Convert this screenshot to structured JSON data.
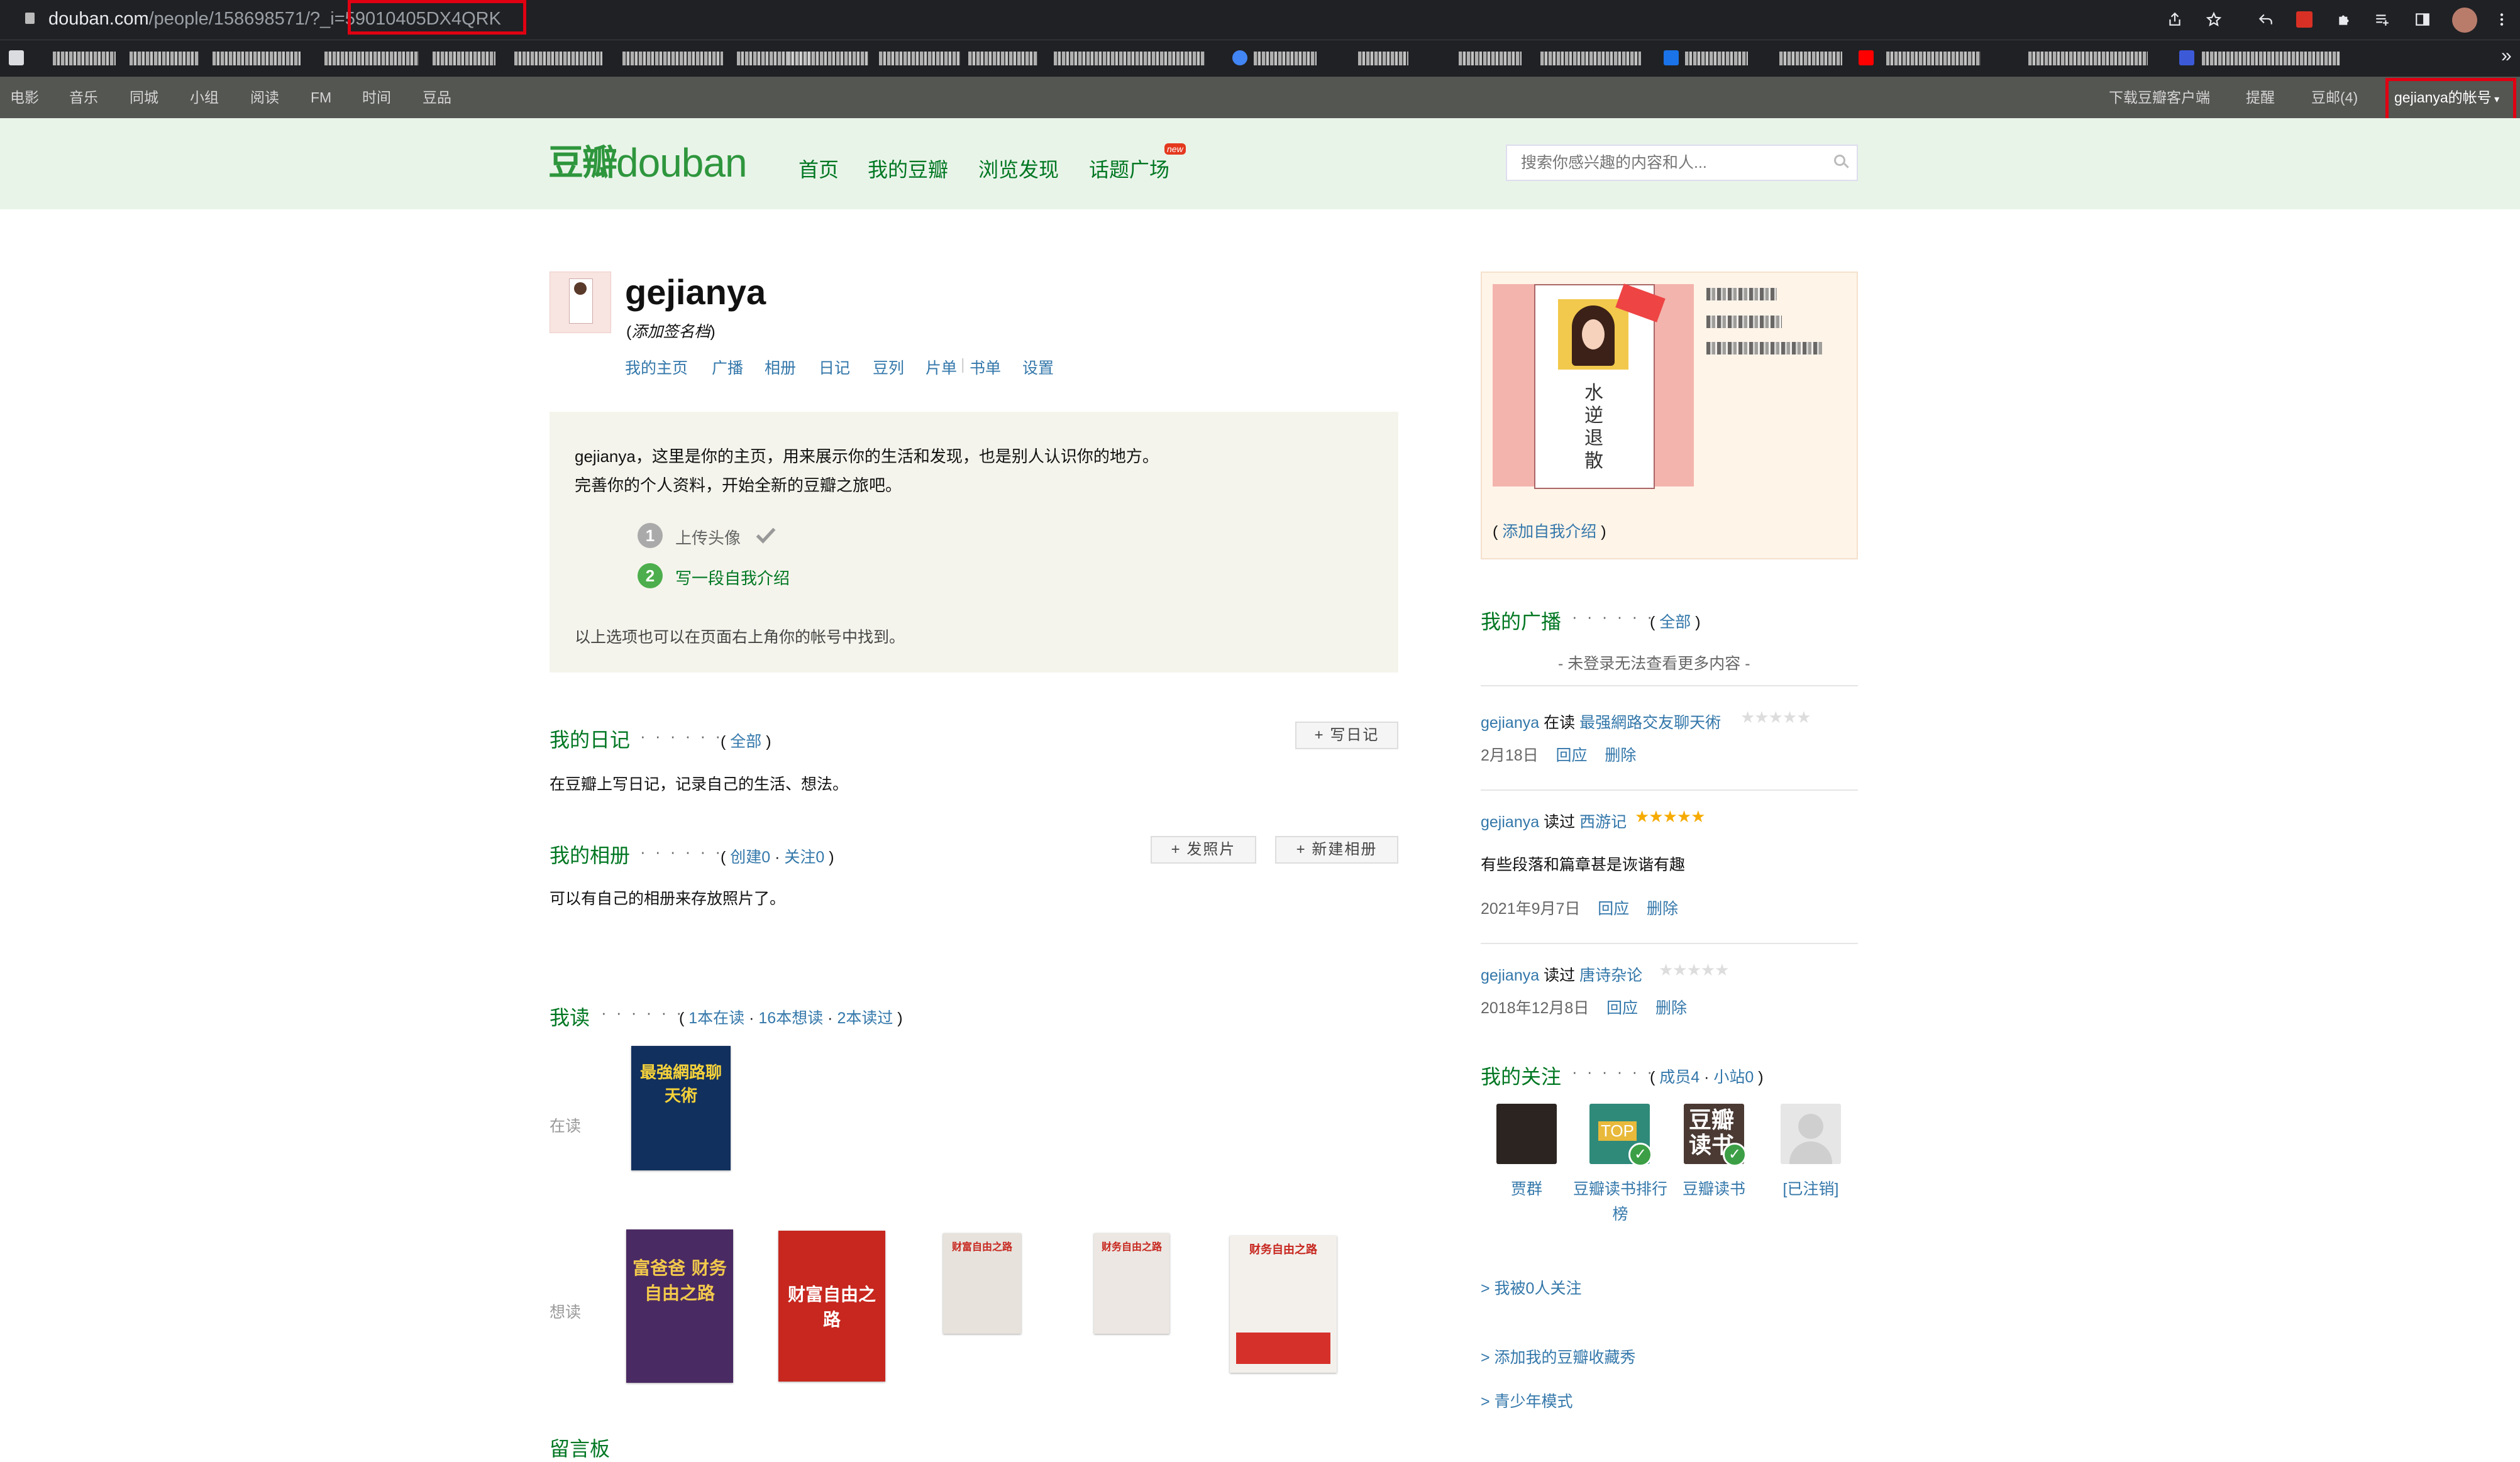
{
  "browser": {
    "url_host": "douban.com",
    "url_path": "/people/158698571/?_i=",
    "url_token": "59010405DX4QRK"
  },
  "global_nav": {
    "items": [
      "电影",
      "音乐",
      "同城",
      "小组",
      "阅读",
      "FM",
      "时间",
      "豆品"
    ],
    "right_items": [
      "下载豆瓣客户端",
      "提醒",
      "豆邮(4)"
    ],
    "account": "gejianya的帐号"
  },
  "header": {
    "logo_cn": "豆瓣",
    "logo_en": "douban",
    "nav": [
      "首页",
      "我的豆瓣",
      "浏览发现",
      "话题广场"
    ],
    "new_badge": "new",
    "search_placeholder": "搜索你感兴趣的内容和人..."
  },
  "profile": {
    "username": "gejianya",
    "signature": "添加签名档",
    "links": [
      "我的主页",
      "广播",
      "相册",
      "日记",
      "豆列",
      "片单",
      "书单",
      "设置"
    ]
  },
  "intro": {
    "line1": "gejianya，这里是你的主页，用来展示你的生活和发现，也是别人认识你的地方。",
    "line2": "完善你的个人资料，开始全新的豆瓣之旅吧。",
    "step1_num": "1",
    "step1": "上传头像",
    "step2_num": "2",
    "step2": "写一段自我介绍",
    "footer": "以上选项也可以在页面右上角你的帐号中找到。"
  },
  "diary": {
    "title": "我的日记",
    "dots": "· · · · · ·",
    "all": "全部",
    "button": "写日记",
    "desc": "在豆瓣上写日记，记录自己的生活、想法。"
  },
  "album": {
    "title": "我的相册",
    "dots": "· · · · · ·",
    "created": "创建0",
    "follow": "关注0",
    "btn_upload": "发照片",
    "btn_new": "新建相册",
    "desc": "可以有自己的相册来存放照片了。"
  },
  "reading": {
    "title": "我读",
    "dots": "· · · · · ·",
    "reading_count": "1本在读",
    "wish_count": "16本想读",
    "read_count": "2本读过",
    "label_reading": "在读",
    "label_wish": "想读",
    "books_reading": [
      {
        "cover_title": "最強網路聊天術",
        "color": "#12305e"
      }
    ],
    "books_wish": [
      {
        "cover_title": "富爸爸 财务自由之路",
        "color": "#4a2a63"
      },
      {
        "cover_title": "财富自由之路",
        "color": "#c7271f"
      },
      {
        "cover_title": "财富自由之路",
        "color": "#e7e2dc"
      },
      {
        "cover_title": "财务自由之路",
        "color": "#ece7e2"
      },
      {
        "cover_title": "财务自由之路",
        "color": "#f3f0ec"
      }
    ],
    "next_section": "留言板"
  },
  "sidebar": {
    "add_intro": "添加自我介绍",
    "broadcast_title": "我的广播",
    "broadcast_dots": "· · · · · ·",
    "broadcast_all": "全部",
    "login_note": "- 未登录无法查看更多内容 -",
    "feed": [
      {
        "user": "gejianya",
        "action": "在读",
        "book": "最强網路交友聊天術",
        "stars": 0,
        "date": "2月18日",
        "reply": "回应",
        "delete": "删除",
        "comment": ""
      },
      {
        "user": "gejianya",
        "action": "读过",
        "book": "西游记",
        "stars": 5,
        "date": "2021年9月7日",
        "reply": "回应",
        "delete": "删除",
        "comment": "有些段落和篇章甚是诙谐有趣"
      },
      {
        "user": "gejianya",
        "action": "读过",
        "book": "唐诗杂论",
        "stars": 0,
        "date": "2018年12月8日",
        "reply": "回应",
        "delete": "删除",
        "comment": ""
      }
    ],
    "follow_title": "我的关注",
    "follow_dots": "· · · · · ·",
    "follow_members": "成员4",
    "follow_sites": "小站0",
    "following": [
      {
        "name": "贾群"
      },
      {
        "name": "豆瓣读书排行榜"
      },
      {
        "name": "豆瓣读书"
      },
      {
        "name": "[已注销]"
      }
    ],
    "followers": "> 我被0人关注",
    "add_show": "> 添加我的豆瓣收藏秀",
    "teen_mode": "> 青少年模式"
  },
  "colors": {
    "douban_green": "#072",
    "link_blue": "#37a",
    "header_bg": "#e9f4e9",
    "highlight_red": "#e00012"
  }
}
